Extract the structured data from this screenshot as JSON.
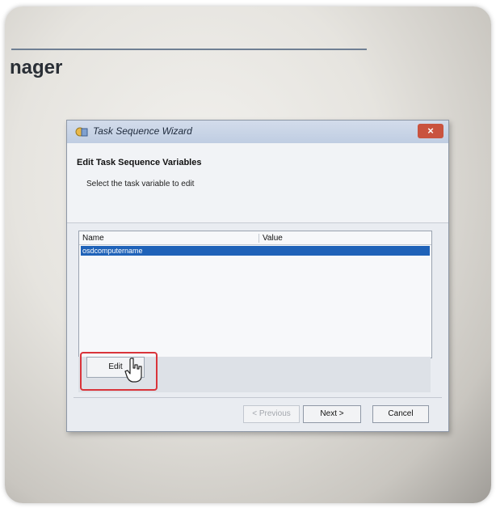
{
  "background": {
    "app_title": "nager"
  },
  "dialog": {
    "title": "Task Sequence Wizard",
    "close_glyph": "×",
    "heading": "Edit Task Sequence Variables",
    "subtitle": "Select the task variable to edit",
    "list": {
      "columns": [
        "Name",
        "Value"
      ],
      "rows": [
        {
          "name": "osdcomputername",
          "value": "",
          "selected": true
        }
      ]
    },
    "edit_label": "Edit",
    "buttons": {
      "previous": "< Previous",
      "next": "Next >",
      "cancel": "Cancel"
    }
  },
  "colors": {
    "selection": "#1f62b8",
    "highlight": "#d9343a",
    "close": "#c9533f"
  }
}
